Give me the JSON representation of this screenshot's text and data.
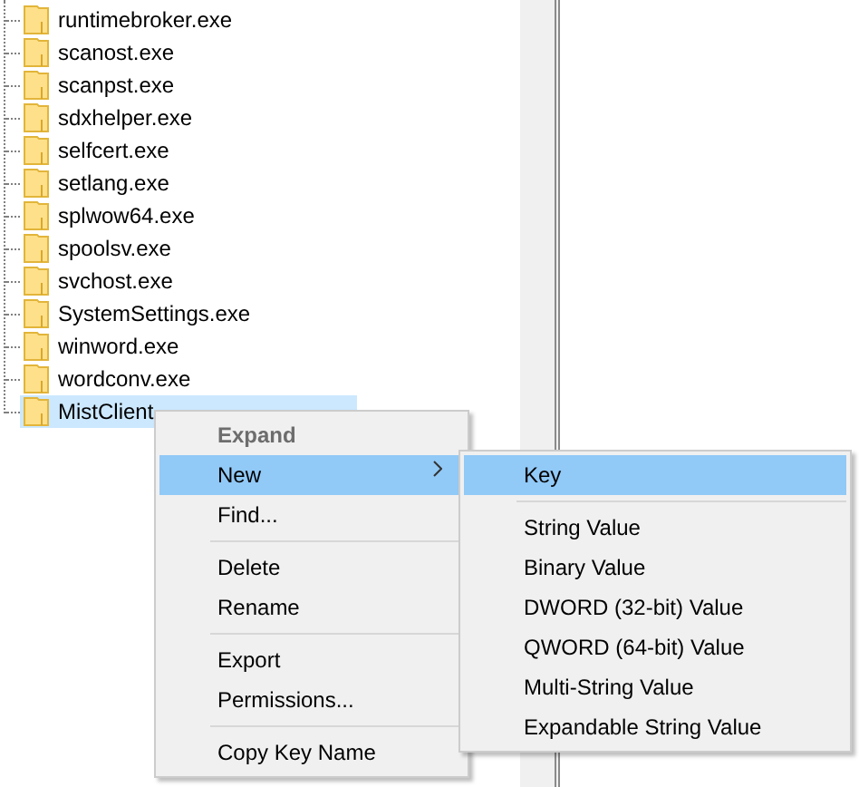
{
  "tree": {
    "items": [
      {
        "label": "runtimebroker.exe",
        "selected": false
      },
      {
        "label": "scanost.exe",
        "selected": false
      },
      {
        "label": "scanpst.exe",
        "selected": false
      },
      {
        "label": "sdxhelper.exe",
        "selected": false
      },
      {
        "label": "selfcert.exe",
        "selected": false
      },
      {
        "label": "setlang.exe",
        "selected": false
      },
      {
        "label": "splwow64.exe",
        "selected": false
      },
      {
        "label": "spoolsv.exe",
        "selected": false
      },
      {
        "label": "svchost.exe",
        "selected": false
      },
      {
        "label": "SystemSettings.exe",
        "selected": false
      },
      {
        "label": "winword.exe",
        "selected": false
      },
      {
        "label": "wordconv.exe",
        "selected": false
      },
      {
        "label": "MistClient",
        "selected": true
      }
    ]
  },
  "context_menu": {
    "items": [
      {
        "kind": "item",
        "label": "Expand",
        "default": true,
        "disabled": true,
        "selected": false,
        "submenu": false
      },
      {
        "kind": "item",
        "label": "New",
        "default": false,
        "disabled": false,
        "selected": true,
        "submenu": true
      },
      {
        "kind": "item",
        "label": "Find...",
        "default": false,
        "disabled": false,
        "selected": false,
        "submenu": false
      },
      {
        "kind": "separator"
      },
      {
        "kind": "item",
        "label": "Delete",
        "default": false,
        "disabled": false,
        "selected": false,
        "submenu": false
      },
      {
        "kind": "item",
        "label": "Rename",
        "default": false,
        "disabled": false,
        "selected": false,
        "submenu": false
      },
      {
        "kind": "separator"
      },
      {
        "kind": "item",
        "label": "Export",
        "default": false,
        "disabled": false,
        "selected": false,
        "submenu": false
      },
      {
        "kind": "item",
        "label": "Permissions...",
        "default": false,
        "disabled": false,
        "selected": false,
        "submenu": false
      },
      {
        "kind": "separator"
      },
      {
        "kind": "item",
        "label": "Copy Key Name",
        "default": false,
        "disabled": false,
        "selected": false,
        "submenu": false
      }
    ]
  },
  "submenu": {
    "items": [
      {
        "kind": "item",
        "label": "Key",
        "default": false,
        "disabled": false,
        "selected": true,
        "submenu": false
      },
      {
        "kind": "separator"
      },
      {
        "kind": "item",
        "label": "String Value",
        "default": false,
        "disabled": false,
        "selected": false,
        "submenu": false
      },
      {
        "kind": "item",
        "label": "Binary Value",
        "default": false,
        "disabled": false,
        "selected": false,
        "submenu": false
      },
      {
        "kind": "item",
        "label": "DWORD (32-bit) Value",
        "default": false,
        "disabled": false,
        "selected": false,
        "submenu": false
      },
      {
        "kind": "item",
        "label": "QWORD (64-bit) Value",
        "default": false,
        "disabled": false,
        "selected": false,
        "submenu": false
      },
      {
        "kind": "item",
        "label": "Multi-String Value",
        "default": false,
        "disabled": false,
        "selected": false,
        "submenu": false
      },
      {
        "kind": "item",
        "label": "Expandable String Value",
        "default": false,
        "disabled": false,
        "selected": false,
        "submenu": false
      }
    ]
  }
}
